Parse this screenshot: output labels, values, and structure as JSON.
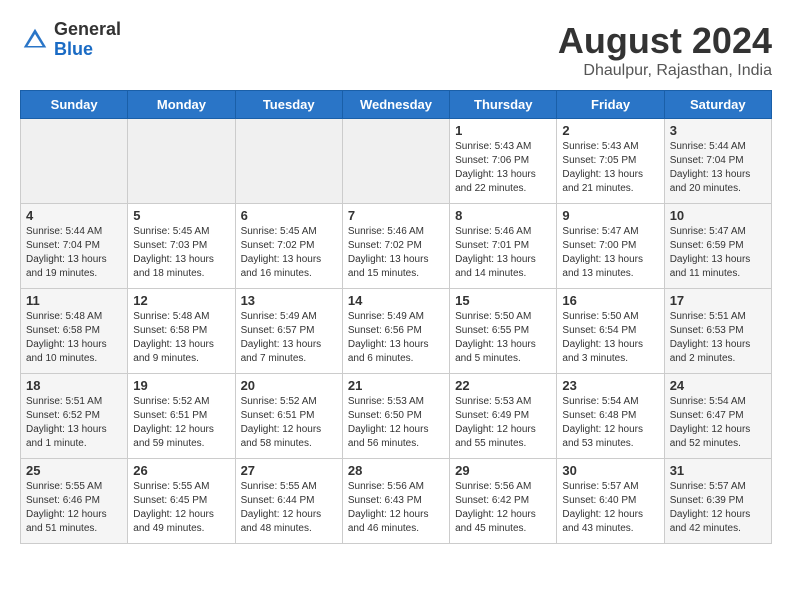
{
  "header": {
    "logo_line1": "General",
    "logo_line2": "Blue",
    "month_title": "August 2024",
    "location": "Dhaulpur, Rajasthan, India"
  },
  "weekdays": [
    "Sunday",
    "Monday",
    "Tuesday",
    "Wednesday",
    "Thursday",
    "Friday",
    "Saturday"
  ],
  "weeks": [
    [
      {
        "day": "",
        "info": "",
        "empty": true
      },
      {
        "day": "",
        "info": "",
        "empty": true
      },
      {
        "day": "",
        "info": "",
        "empty": true
      },
      {
        "day": "",
        "info": "",
        "empty": true
      },
      {
        "day": "1",
        "info": "Sunrise: 5:43 AM\nSunset: 7:06 PM\nDaylight: 13 hours\nand 22 minutes.",
        "empty": false
      },
      {
        "day": "2",
        "info": "Sunrise: 5:43 AM\nSunset: 7:05 PM\nDaylight: 13 hours\nand 21 minutes.",
        "empty": false
      },
      {
        "day": "3",
        "info": "Sunrise: 5:44 AM\nSunset: 7:04 PM\nDaylight: 13 hours\nand 20 minutes.",
        "empty": false
      }
    ],
    [
      {
        "day": "4",
        "info": "Sunrise: 5:44 AM\nSunset: 7:04 PM\nDaylight: 13 hours\nand 19 minutes.",
        "empty": false
      },
      {
        "day": "5",
        "info": "Sunrise: 5:45 AM\nSunset: 7:03 PM\nDaylight: 13 hours\nand 18 minutes.",
        "empty": false
      },
      {
        "day": "6",
        "info": "Sunrise: 5:45 AM\nSunset: 7:02 PM\nDaylight: 13 hours\nand 16 minutes.",
        "empty": false
      },
      {
        "day": "7",
        "info": "Sunrise: 5:46 AM\nSunset: 7:02 PM\nDaylight: 13 hours\nand 15 minutes.",
        "empty": false
      },
      {
        "day": "8",
        "info": "Sunrise: 5:46 AM\nSunset: 7:01 PM\nDaylight: 13 hours\nand 14 minutes.",
        "empty": false
      },
      {
        "day": "9",
        "info": "Sunrise: 5:47 AM\nSunset: 7:00 PM\nDaylight: 13 hours\nand 13 minutes.",
        "empty": false
      },
      {
        "day": "10",
        "info": "Sunrise: 5:47 AM\nSunset: 6:59 PM\nDaylight: 13 hours\nand 11 minutes.",
        "empty": false
      }
    ],
    [
      {
        "day": "11",
        "info": "Sunrise: 5:48 AM\nSunset: 6:58 PM\nDaylight: 13 hours\nand 10 minutes.",
        "empty": false
      },
      {
        "day": "12",
        "info": "Sunrise: 5:48 AM\nSunset: 6:58 PM\nDaylight: 13 hours\nand 9 minutes.",
        "empty": false
      },
      {
        "day": "13",
        "info": "Sunrise: 5:49 AM\nSunset: 6:57 PM\nDaylight: 13 hours\nand 7 minutes.",
        "empty": false
      },
      {
        "day": "14",
        "info": "Sunrise: 5:49 AM\nSunset: 6:56 PM\nDaylight: 13 hours\nand 6 minutes.",
        "empty": false
      },
      {
        "day": "15",
        "info": "Sunrise: 5:50 AM\nSunset: 6:55 PM\nDaylight: 13 hours\nand 5 minutes.",
        "empty": false
      },
      {
        "day": "16",
        "info": "Sunrise: 5:50 AM\nSunset: 6:54 PM\nDaylight: 13 hours\nand 3 minutes.",
        "empty": false
      },
      {
        "day": "17",
        "info": "Sunrise: 5:51 AM\nSunset: 6:53 PM\nDaylight: 13 hours\nand 2 minutes.",
        "empty": false
      }
    ],
    [
      {
        "day": "18",
        "info": "Sunrise: 5:51 AM\nSunset: 6:52 PM\nDaylight: 13 hours\nand 1 minute.",
        "empty": false
      },
      {
        "day": "19",
        "info": "Sunrise: 5:52 AM\nSunset: 6:51 PM\nDaylight: 12 hours\nand 59 minutes.",
        "empty": false
      },
      {
        "day": "20",
        "info": "Sunrise: 5:52 AM\nSunset: 6:51 PM\nDaylight: 12 hours\nand 58 minutes.",
        "empty": false
      },
      {
        "day": "21",
        "info": "Sunrise: 5:53 AM\nSunset: 6:50 PM\nDaylight: 12 hours\nand 56 minutes.",
        "empty": false
      },
      {
        "day": "22",
        "info": "Sunrise: 5:53 AM\nSunset: 6:49 PM\nDaylight: 12 hours\nand 55 minutes.",
        "empty": false
      },
      {
        "day": "23",
        "info": "Sunrise: 5:54 AM\nSunset: 6:48 PM\nDaylight: 12 hours\nand 53 minutes.",
        "empty": false
      },
      {
        "day": "24",
        "info": "Sunrise: 5:54 AM\nSunset: 6:47 PM\nDaylight: 12 hours\nand 52 minutes.",
        "empty": false
      }
    ],
    [
      {
        "day": "25",
        "info": "Sunrise: 5:55 AM\nSunset: 6:46 PM\nDaylight: 12 hours\nand 51 minutes.",
        "empty": false
      },
      {
        "day": "26",
        "info": "Sunrise: 5:55 AM\nSunset: 6:45 PM\nDaylight: 12 hours\nand 49 minutes.",
        "empty": false
      },
      {
        "day": "27",
        "info": "Sunrise: 5:55 AM\nSunset: 6:44 PM\nDaylight: 12 hours\nand 48 minutes.",
        "empty": false
      },
      {
        "day": "28",
        "info": "Sunrise: 5:56 AM\nSunset: 6:43 PM\nDaylight: 12 hours\nand 46 minutes.",
        "empty": false
      },
      {
        "day": "29",
        "info": "Sunrise: 5:56 AM\nSunset: 6:42 PM\nDaylight: 12 hours\nand 45 minutes.",
        "empty": false
      },
      {
        "day": "30",
        "info": "Sunrise: 5:57 AM\nSunset: 6:40 PM\nDaylight: 12 hours\nand 43 minutes.",
        "empty": false
      },
      {
        "day": "31",
        "info": "Sunrise: 5:57 AM\nSunset: 6:39 PM\nDaylight: 12 hours\nand 42 minutes.",
        "empty": false
      }
    ]
  ]
}
